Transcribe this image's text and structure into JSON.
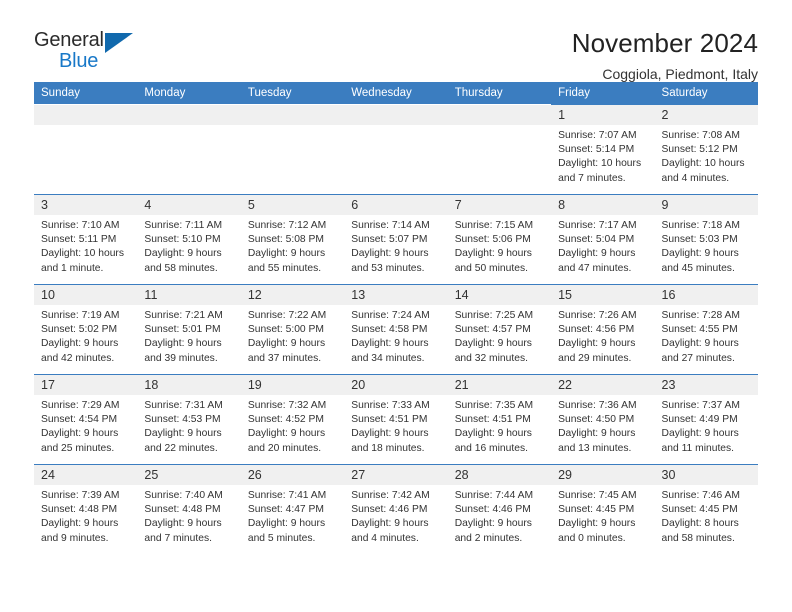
{
  "brand": {
    "line1": "General",
    "line2": "Blue",
    "triangle_color": "#1169ad",
    "blue_color": "#1878c8"
  },
  "header": {
    "title": "November 2024",
    "subtitle": "Coggiola, Piedmont, Italy"
  },
  "theme": {
    "header_bg": "#3b7dc0",
    "daynum_bg": "#f0f0f0",
    "text": "#333333"
  },
  "weekday_headers": [
    "Sunday",
    "Monday",
    "Tuesday",
    "Wednesday",
    "Thursday",
    "Friday",
    "Saturday"
  ],
  "weeks": [
    [
      {
        "empty": true
      },
      {
        "empty": true
      },
      {
        "empty": true
      },
      {
        "empty": true
      },
      {
        "empty": true
      },
      {
        "day": "1",
        "sunrise": "Sunrise: 7:07 AM",
        "sunset": "Sunset: 5:14 PM",
        "daylight": "Daylight: 10 hours and 7 minutes."
      },
      {
        "day": "2",
        "sunrise": "Sunrise: 7:08 AM",
        "sunset": "Sunset: 5:12 PM",
        "daylight": "Daylight: 10 hours and 4 minutes."
      }
    ],
    [
      {
        "day": "3",
        "sunrise": "Sunrise: 7:10 AM",
        "sunset": "Sunset: 5:11 PM",
        "daylight": "Daylight: 10 hours and 1 minute."
      },
      {
        "day": "4",
        "sunrise": "Sunrise: 7:11 AM",
        "sunset": "Sunset: 5:10 PM",
        "daylight": "Daylight: 9 hours and 58 minutes."
      },
      {
        "day": "5",
        "sunrise": "Sunrise: 7:12 AM",
        "sunset": "Sunset: 5:08 PM",
        "daylight": "Daylight: 9 hours and 55 minutes."
      },
      {
        "day": "6",
        "sunrise": "Sunrise: 7:14 AM",
        "sunset": "Sunset: 5:07 PM",
        "daylight": "Daylight: 9 hours and 53 minutes."
      },
      {
        "day": "7",
        "sunrise": "Sunrise: 7:15 AM",
        "sunset": "Sunset: 5:06 PM",
        "daylight": "Daylight: 9 hours and 50 minutes."
      },
      {
        "day": "8",
        "sunrise": "Sunrise: 7:17 AM",
        "sunset": "Sunset: 5:04 PM",
        "daylight": "Daylight: 9 hours and 47 minutes."
      },
      {
        "day": "9",
        "sunrise": "Sunrise: 7:18 AM",
        "sunset": "Sunset: 5:03 PM",
        "daylight": "Daylight: 9 hours and 45 minutes."
      }
    ],
    [
      {
        "day": "10",
        "sunrise": "Sunrise: 7:19 AM",
        "sunset": "Sunset: 5:02 PM",
        "daylight": "Daylight: 9 hours and 42 minutes."
      },
      {
        "day": "11",
        "sunrise": "Sunrise: 7:21 AM",
        "sunset": "Sunset: 5:01 PM",
        "daylight": "Daylight: 9 hours and 39 minutes."
      },
      {
        "day": "12",
        "sunrise": "Sunrise: 7:22 AM",
        "sunset": "Sunset: 5:00 PM",
        "daylight": "Daylight: 9 hours and 37 minutes."
      },
      {
        "day": "13",
        "sunrise": "Sunrise: 7:24 AM",
        "sunset": "Sunset: 4:58 PM",
        "daylight": "Daylight: 9 hours and 34 minutes."
      },
      {
        "day": "14",
        "sunrise": "Sunrise: 7:25 AM",
        "sunset": "Sunset: 4:57 PM",
        "daylight": "Daylight: 9 hours and 32 minutes."
      },
      {
        "day": "15",
        "sunrise": "Sunrise: 7:26 AM",
        "sunset": "Sunset: 4:56 PM",
        "daylight": "Daylight: 9 hours and 29 minutes."
      },
      {
        "day": "16",
        "sunrise": "Sunrise: 7:28 AM",
        "sunset": "Sunset: 4:55 PM",
        "daylight": "Daylight: 9 hours and 27 minutes."
      }
    ],
    [
      {
        "day": "17",
        "sunrise": "Sunrise: 7:29 AM",
        "sunset": "Sunset: 4:54 PM",
        "daylight": "Daylight: 9 hours and 25 minutes."
      },
      {
        "day": "18",
        "sunrise": "Sunrise: 7:31 AM",
        "sunset": "Sunset: 4:53 PM",
        "daylight": "Daylight: 9 hours and 22 minutes."
      },
      {
        "day": "19",
        "sunrise": "Sunrise: 7:32 AM",
        "sunset": "Sunset: 4:52 PM",
        "daylight": "Daylight: 9 hours and 20 minutes."
      },
      {
        "day": "20",
        "sunrise": "Sunrise: 7:33 AM",
        "sunset": "Sunset: 4:51 PM",
        "daylight": "Daylight: 9 hours and 18 minutes."
      },
      {
        "day": "21",
        "sunrise": "Sunrise: 7:35 AM",
        "sunset": "Sunset: 4:51 PM",
        "daylight": "Daylight: 9 hours and 16 minutes."
      },
      {
        "day": "22",
        "sunrise": "Sunrise: 7:36 AM",
        "sunset": "Sunset: 4:50 PM",
        "daylight": "Daylight: 9 hours and 13 minutes."
      },
      {
        "day": "23",
        "sunrise": "Sunrise: 7:37 AM",
        "sunset": "Sunset: 4:49 PM",
        "daylight": "Daylight: 9 hours and 11 minutes."
      }
    ],
    [
      {
        "day": "24",
        "sunrise": "Sunrise: 7:39 AM",
        "sunset": "Sunset: 4:48 PM",
        "daylight": "Daylight: 9 hours and 9 minutes."
      },
      {
        "day": "25",
        "sunrise": "Sunrise: 7:40 AM",
        "sunset": "Sunset: 4:48 PM",
        "daylight": "Daylight: 9 hours and 7 minutes."
      },
      {
        "day": "26",
        "sunrise": "Sunrise: 7:41 AM",
        "sunset": "Sunset: 4:47 PM",
        "daylight": "Daylight: 9 hours and 5 minutes."
      },
      {
        "day": "27",
        "sunrise": "Sunrise: 7:42 AM",
        "sunset": "Sunset: 4:46 PM",
        "daylight": "Daylight: 9 hours and 4 minutes."
      },
      {
        "day": "28",
        "sunrise": "Sunrise: 7:44 AM",
        "sunset": "Sunset: 4:46 PM",
        "daylight": "Daylight: 9 hours and 2 minutes."
      },
      {
        "day": "29",
        "sunrise": "Sunrise: 7:45 AM",
        "sunset": "Sunset: 4:45 PM",
        "daylight": "Daylight: 9 hours and 0 minutes."
      },
      {
        "day": "30",
        "sunrise": "Sunrise: 7:46 AM",
        "sunset": "Sunset: 4:45 PM",
        "daylight": "Daylight: 8 hours and 58 minutes."
      }
    ]
  ]
}
